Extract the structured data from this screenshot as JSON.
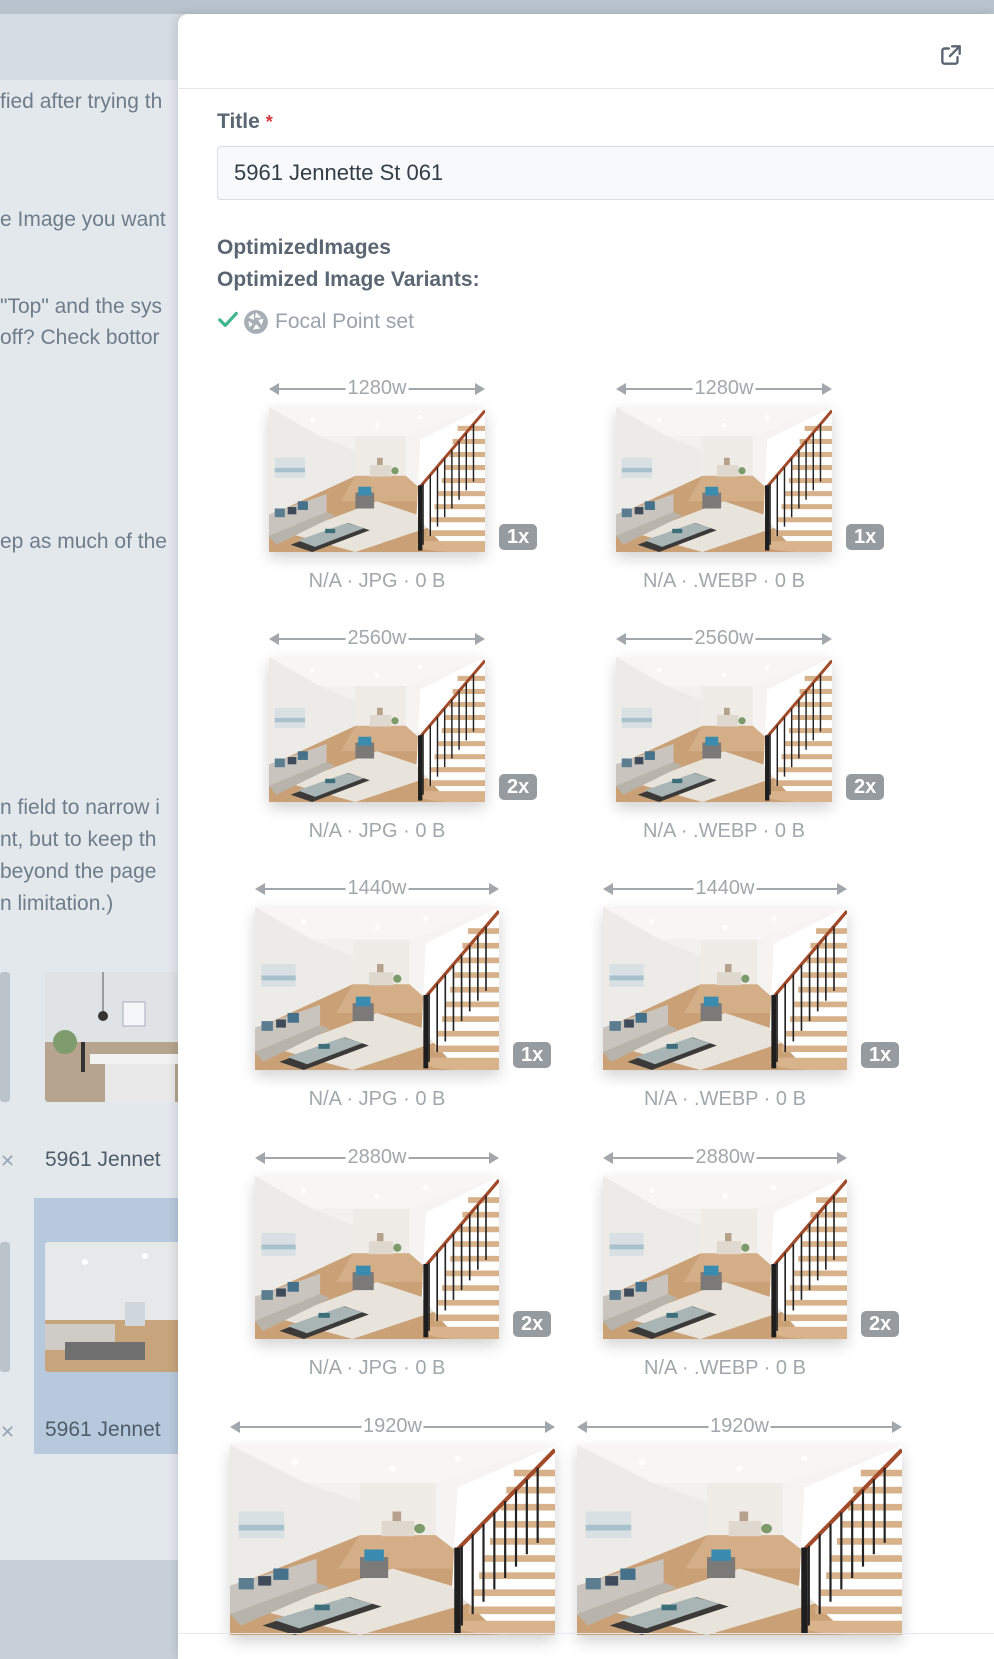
{
  "background": {
    "text_lines": [
      "fied after trying th",
      "e Image you want",
      "\"Top\" and the sys",
      "off? Check bottor",
      "ep as much of the",
      "n field to narrow i",
      "nt, but to keep th",
      " beyond the page",
      "n limitation.)"
    ],
    "thumb_captions": [
      "5961 Jennet",
      "5961 Jennet"
    ]
  },
  "drawer": {
    "external_link_icon": "external-link-icon",
    "title_label": "Title",
    "required_mark": "*",
    "title_value": "5961 Jennette St 061",
    "section_line1": "OptimizedImages",
    "section_line2": "Optimized Image Variants:",
    "focal_point_text": "Focal Point set",
    "focal_icons": [
      "check-icon",
      "aperture-icon"
    ]
  },
  "variants": [
    {
      "width_label": "1280w",
      "density": "1x",
      "meta": "N/A · JPG · 0 B"
    },
    {
      "width_label": "1280w",
      "density": "1x",
      "meta": "N/A · .WEBP · 0 B"
    },
    {
      "width_label": "2560w",
      "density": "2x",
      "meta": "N/A · JPG · 0 B"
    },
    {
      "width_label": "2560w",
      "density": "2x",
      "meta": "N/A · .WEBP · 0 B"
    },
    {
      "width_label": "1440w",
      "density": "1x",
      "meta": "N/A · JPG · 0 B"
    },
    {
      "width_label": "1440w",
      "density": "1x",
      "meta": "N/A · .WEBP · 0 B"
    },
    {
      "width_label": "2880w",
      "density": "2x",
      "meta": "N/A · JPG · 0 B"
    },
    {
      "width_label": "2880w",
      "density": "2x",
      "meta": "N/A · .WEBP · 0 B"
    },
    {
      "width_label": "1920w",
      "density": "",
      "meta": ""
    },
    {
      "width_label": "1920w",
      "density": "",
      "meta": ""
    }
  ]
}
